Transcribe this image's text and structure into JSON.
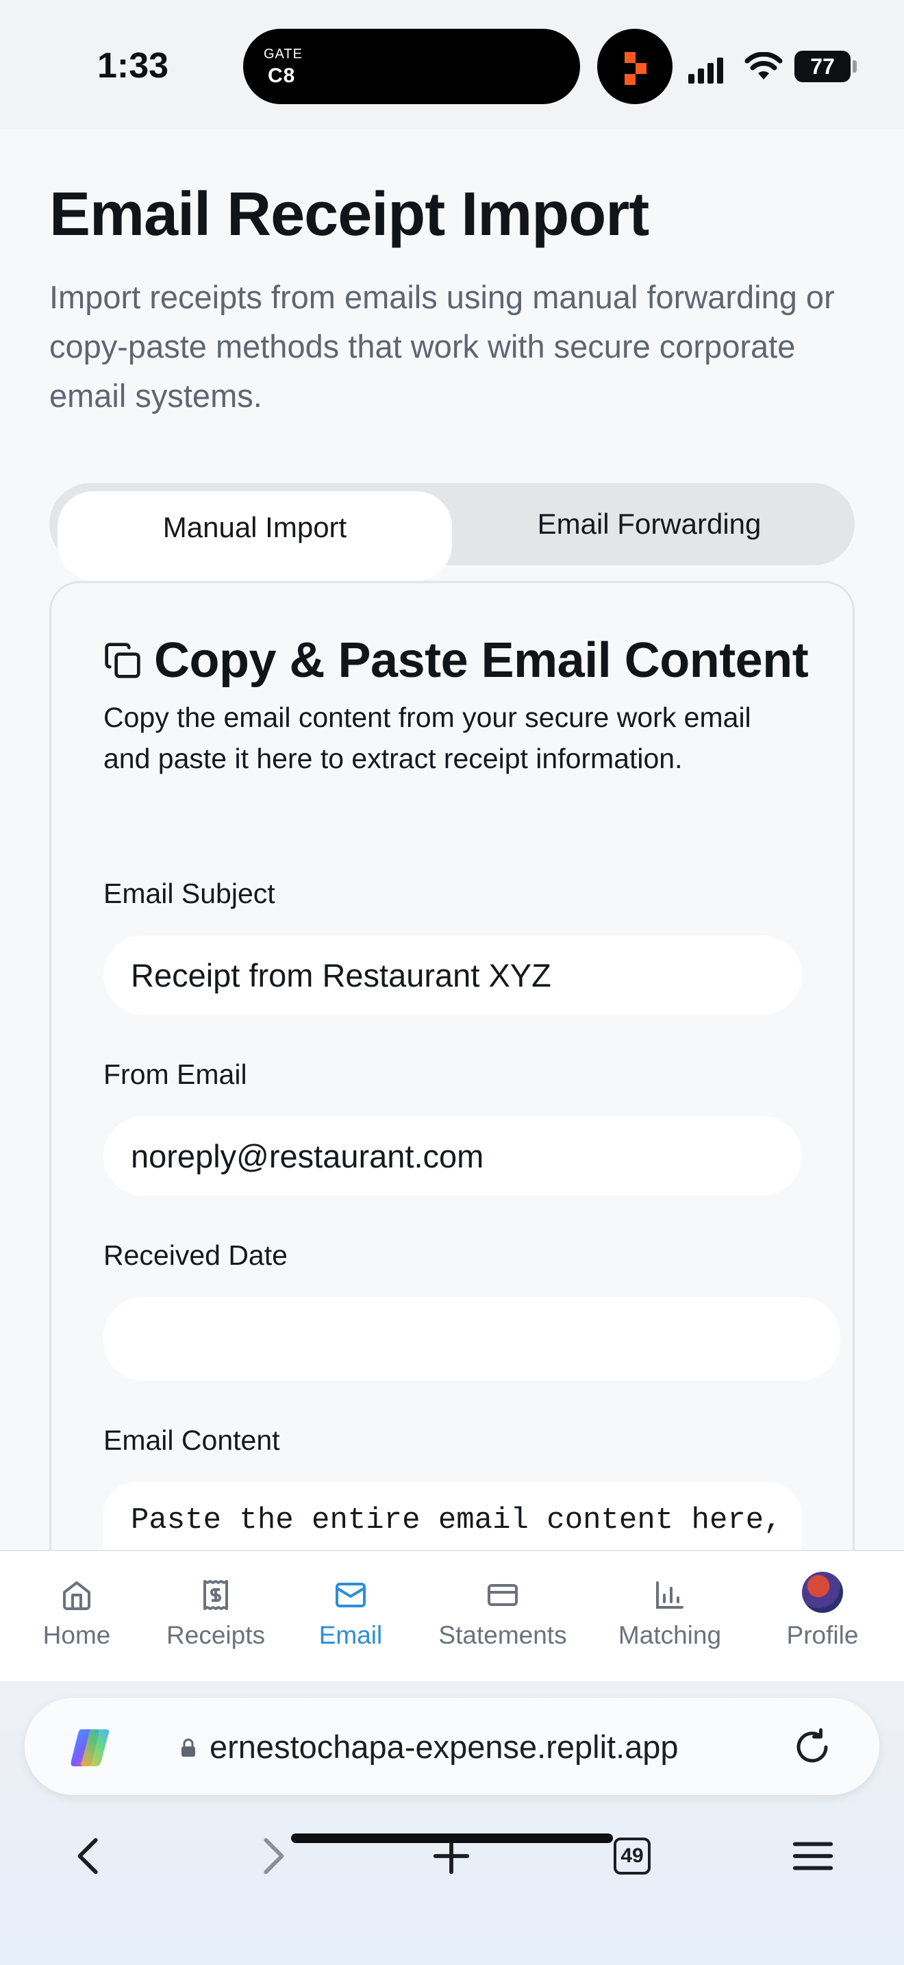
{
  "status_bar": {
    "time": "1:33",
    "gate_label": "GATE",
    "gate_value": "C8",
    "battery": "77"
  },
  "header": {
    "title": "Email Receipt Import",
    "subtitle": "Import receipts from emails using manual forwarding or copy-paste methods that work with secure corporate email systems."
  },
  "tabs": [
    {
      "label": "Manual Import",
      "active": true
    },
    {
      "label": "Email Forwarding",
      "active": false
    }
  ],
  "card": {
    "icon": "copy-icon",
    "title": "Copy & Paste Email Content",
    "description": "Copy the email content from your secure work email and paste it here to extract receipt information.",
    "fields": {
      "subject": {
        "label": "Email Subject",
        "value": "Receipt from Restaurant XYZ"
      },
      "from": {
        "label": "From Email",
        "value": "noreply@restaurant.com"
      },
      "date": {
        "label": "Received Date",
        "value": ""
      },
      "content": {
        "label": "Email Content",
        "placeholder": "Paste the entire email content here,"
      }
    }
  },
  "bottom_nav": [
    {
      "label": "Home",
      "icon": "home-icon",
      "active": false
    },
    {
      "label": "Receipts",
      "icon": "receipt-icon",
      "active": false
    },
    {
      "label": "Email",
      "icon": "mail-icon",
      "active": true
    },
    {
      "label": "Statements",
      "icon": "credit-card-icon",
      "active": false
    },
    {
      "label": "Matching",
      "icon": "bar-chart-icon",
      "active": false
    },
    {
      "label": "Profile",
      "icon": "avatar",
      "active": false
    }
  ],
  "browser": {
    "url": "ernestochapa-expense.replit.app",
    "tab_count": "49"
  },
  "colors": {
    "accent": "#2a8fd8",
    "text": "#111418",
    "muted": "#5f6571"
  }
}
